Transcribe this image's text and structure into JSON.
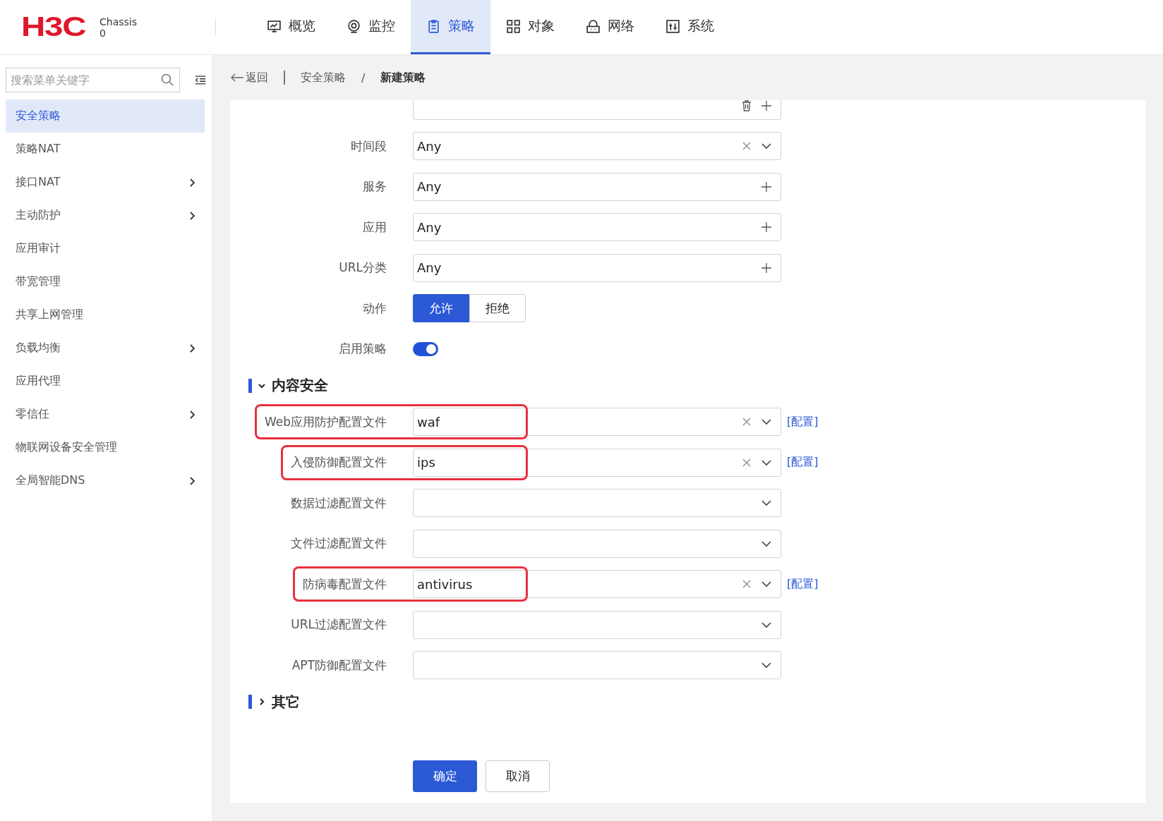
{
  "header": {
    "logo": "H3C",
    "device": [
      "Chassis",
      "0"
    ],
    "nav": [
      {
        "label": "概览",
        "selected": false
      },
      {
        "label": "监控",
        "selected": false
      },
      {
        "label": "策略",
        "selected": true
      },
      {
        "label": "对象",
        "selected": false
      },
      {
        "label": "网络",
        "selected": false
      },
      {
        "label": "系统",
        "selected": false
      }
    ]
  },
  "sidebar": {
    "search": {
      "placeholder": "搜索菜单关键字"
    },
    "items": [
      {
        "label": "安全策略",
        "selected": true,
        "has_children": false
      },
      {
        "label": "策略NAT",
        "selected": false,
        "has_children": false
      },
      {
        "label": "接口NAT",
        "selected": false,
        "has_children": true
      },
      {
        "label": "主动防护",
        "selected": false,
        "has_children": true
      },
      {
        "label": "应用审计",
        "selected": false,
        "has_children": false
      },
      {
        "label": "带宽管理",
        "selected": false,
        "has_children": false
      },
      {
        "label": "共享上网管理",
        "selected": false,
        "has_children": false
      },
      {
        "label": "负载均衡",
        "selected": false,
        "has_children": true
      },
      {
        "label": "应用代理",
        "selected": false,
        "has_children": false
      },
      {
        "label": "零信任",
        "selected": false,
        "has_children": true
      },
      {
        "label": "物联网设备安全管理",
        "selected": false,
        "has_children": false
      },
      {
        "label": "全局智能DNS",
        "selected": false,
        "has_children": true
      }
    ]
  },
  "breadcrumb": {
    "back": "返回",
    "separator": "/",
    "items": [
      "安全策略",
      "新建策略"
    ]
  },
  "form": {
    "rows": [
      {
        "kind": "list"
      },
      {
        "kind": "select",
        "label": "时间段",
        "value": "Any",
        "clearable": true
      },
      {
        "kind": "add",
        "label": "服务",
        "value": "Any"
      },
      {
        "kind": "add",
        "label": "应用",
        "value": "Any"
      },
      {
        "kind": "add",
        "label": "URL分类",
        "value": "Any"
      },
      {
        "kind": "segmented",
        "label": "动作",
        "options": [
          {
            "label": "允许",
            "selected": true
          },
          {
            "label": "拒绝",
            "selected": false
          }
        ]
      },
      {
        "kind": "toggle",
        "label": "启用策略",
        "on": true
      }
    ],
    "sections": [
      {
        "title": "内容安全",
        "expanded": true,
        "rows": [
          {
            "kind": "select",
            "label": "Web应用防护配置文件",
            "value": "waf",
            "clearable": true,
            "highlighted": true,
            "link": "[配置]"
          },
          {
            "kind": "select",
            "label": "入侵防御配置文件",
            "value": "ips",
            "clearable": true,
            "highlighted": true,
            "link": "[配置]"
          },
          {
            "kind": "select",
            "label": "数据过滤配置文件",
            "clearable": false,
            "highlighted": false
          },
          {
            "kind": "select",
            "label": "文件过滤配置文件",
            "clearable": false,
            "highlighted": false
          },
          {
            "kind": "select",
            "label": "防病毒配置文件",
            "value": "antivirus",
            "clearable": true,
            "highlighted": true,
            "link": "[配置]"
          },
          {
            "kind": "select",
            "label": "URL过滤配置文件",
            "clearable": false,
            "highlighted": false
          },
          {
            "kind": "select",
            "label": "APT防御配置文件",
            "clearable": false,
            "highlighted": false
          }
        ]
      },
      {
        "title": "其它",
        "expanded": false
      }
    ],
    "buttons": [
      {
        "label": "确定",
        "kind": "primary"
      },
      {
        "label": "取消",
        "kind": "default"
      }
    ]
  }
}
